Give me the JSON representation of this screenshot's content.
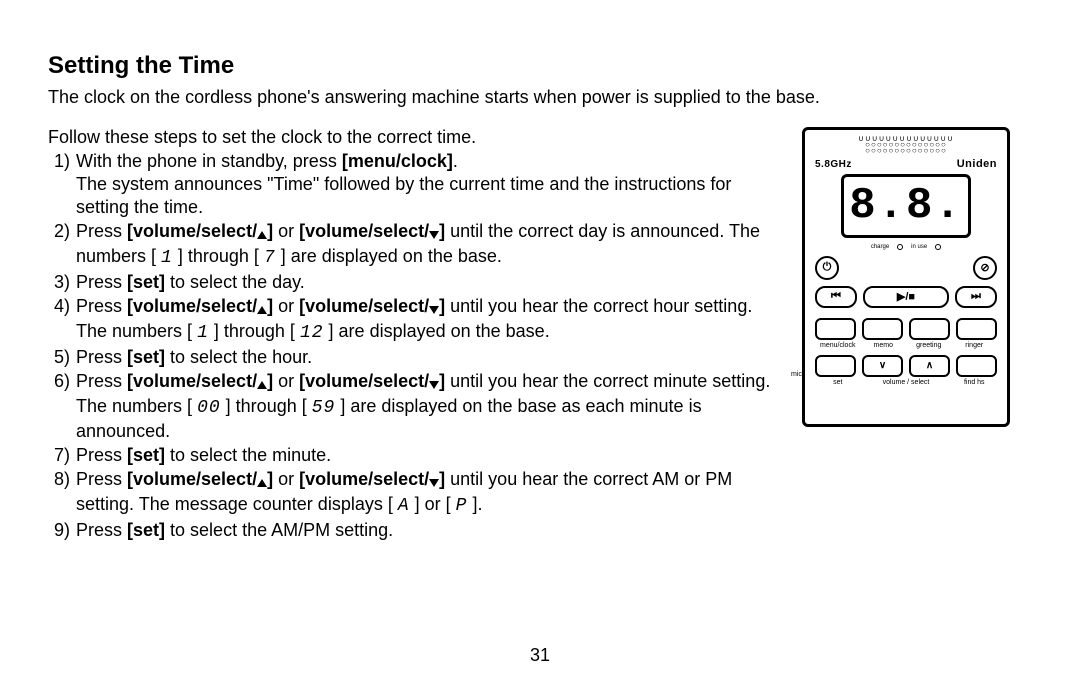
{
  "heading": "Setting the Time",
  "intro": "The clock on the cordless phone's answering machine starts when power is supplied to the base.",
  "lead": "Follow these steps to set the clock to the correct time.",
  "steps": {
    "s1a": "With the phone in standby, press ",
    "s1b": "[menu/clock]",
    "s1c": ".",
    "s1d": "The system announces \"Time\" followed by the current time and the instructions for setting the time.",
    "s2a": "Press ",
    "s2b": "[volume/select/",
    "s2c": "]",
    "s2d": " or ",
    "s2e": "[volume/select/",
    "s2f": "]",
    "s2g": " until the correct day is announced. The numbers [ ",
    "s2seg1": "1",
    "s2h": " ] through [ ",
    "s2seg2": "7",
    "s2i": " ] are displayed on the base.",
    "s3": "Press ",
    "s3b": "[set]",
    "s3c": " to select the day.",
    "s4a": "Press ",
    "s4b": "[volume/select/",
    "s4c": "]",
    "s4d": " or ",
    "s4e": "[volume/select/",
    "s4f": "]",
    "s4g": " until you hear the correct hour setting. The numbers [  ",
    "s4seg1": "1",
    "s4h": " ] through [ ",
    "s4seg2": "12",
    "s4i": " ] are displayed on the base.",
    "s5": "Press ",
    "s5b": "[set]",
    "s5c": " to select the hour.",
    "s6a": "Press ",
    "s6b": "[volume/select/",
    "s6c": "]",
    "s6d": " or ",
    "s6e": "[volume/select/",
    "s6f": "]",
    "s6g": " until you hear the correct minute setting. The numbers [ ",
    "s6seg1": "00",
    "s6h": " ] through [ ",
    "s6seg2": "59",
    "s6i": " ] are displayed on the base as each minute is announced.",
    "s7": "Press ",
    "s7b": "[set]",
    "s7c": " to select the minute.",
    "s8a": "Press ",
    "s8b": "[volume/select/",
    "s8c": "]",
    "s8d": " or ",
    "s8e": "[volume/select/",
    "s8f": "]",
    "s8g": " until you hear the correct AM or PM setting. The message counter displays [ ",
    "s8seg1": "A",
    "s8h": " ] or [ ",
    "s8seg2": "P",
    "s8i": " ].",
    "s9": "Press ",
    "s9b": "[set]",
    "s9c": " to select the AM/PM setting."
  },
  "device": {
    "ghz": "5.8GHz",
    "brand": "Uniden",
    "lcd": "8.8.",
    "led_charge": "charge",
    "led_inuse": "in use",
    "btn_power": "⏻",
    "btn_nopark": "⊘",
    "btn_prev": "⏮",
    "btn_play": "▶/■",
    "btn_next": "⏭",
    "lbl_menu": "menu/clock",
    "lbl_memo": "memo",
    "lbl_greet": "greeting",
    "lbl_ringer": "ringer",
    "lbl_set": "set",
    "lbl_volsel": "volume / select",
    "lbl_findhs": "find hs",
    "lbl_mic": "mic",
    "arrow_up": "∧",
    "arrow_down": "∨"
  },
  "page_number": "31"
}
